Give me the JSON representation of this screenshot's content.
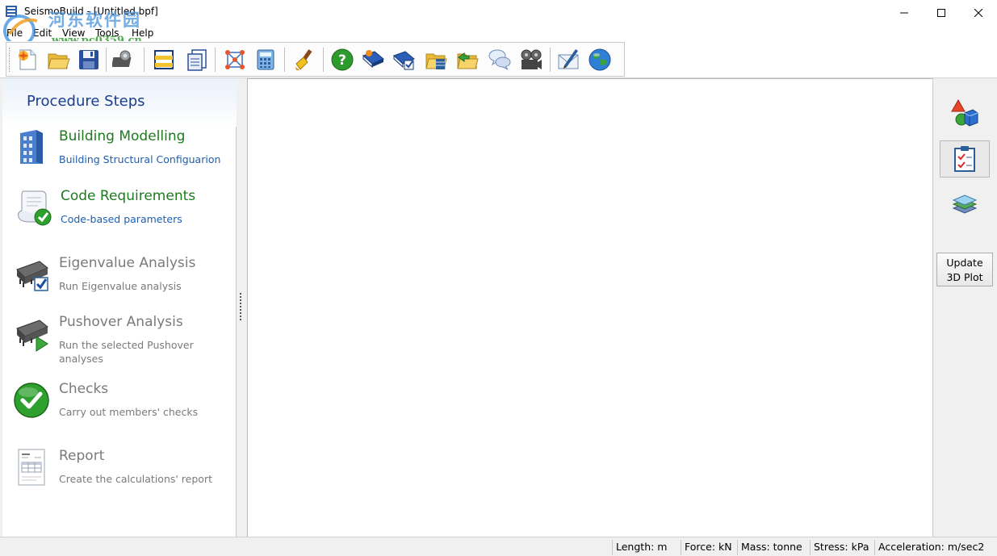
{
  "window": {
    "title": "SeismoBuild - [Untitled.bpf]",
    "watermark": "河东软件园",
    "watermark_url": "www.pc0359.cn"
  },
  "menu": [
    "File",
    "Edit",
    "View",
    "Tools",
    "Help"
  ],
  "toolbar": {
    "icons": [
      "new-file-icon",
      "open-folder-icon",
      "save-icon",
      "settings-chip-icon",
      "frame-icon",
      "report-icon",
      "model-nodes-icon",
      "calculator-icon",
      "brush-icon",
      "help-icon",
      "manual-book-icon",
      "check-book-icon",
      "folder-building-icon",
      "folder-arrow-icon",
      "chat-icon",
      "video-icon",
      "email-icon",
      "globe-icon"
    ]
  },
  "procedure": {
    "title": "Procedure Steps",
    "steps": [
      {
        "title": "Building Modelling",
        "desc": "Building Structural Configuarion",
        "active": true
      },
      {
        "title": "Code Requirements",
        "desc": "Code-based parameters",
        "active": true
      },
      {
        "title": "Eigenvalue Analysis",
        "desc": "Run Eigenvalue analysis",
        "active": false
      },
      {
        "title": "Pushover Analysis",
        "desc": "Run the selected Pushover analyses",
        "active": false
      },
      {
        "title": "Checks",
        "desc": "Carry out members' checks",
        "active": false
      },
      {
        "title": "Report",
        "desc": "Create the calculations' report",
        "active": false
      }
    ]
  },
  "right_panel": {
    "update_label_1": "Update",
    "update_label_2": "3D Plot"
  },
  "status": {
    "length": "Length: m",
    "force": "Force: kN",
    "mass": "Mass: tonne",
    "stress": "Stress: kPa",
    "acceleration": "Acceleration: m/sec2"
  },
  "colors": {
    "active_title": "#1e7a1e",
    "active_desc": "#1a5fb4",
    "inactive": "#7a7a7a",
    "panel_title": "#1a3d8f"
  }
}
